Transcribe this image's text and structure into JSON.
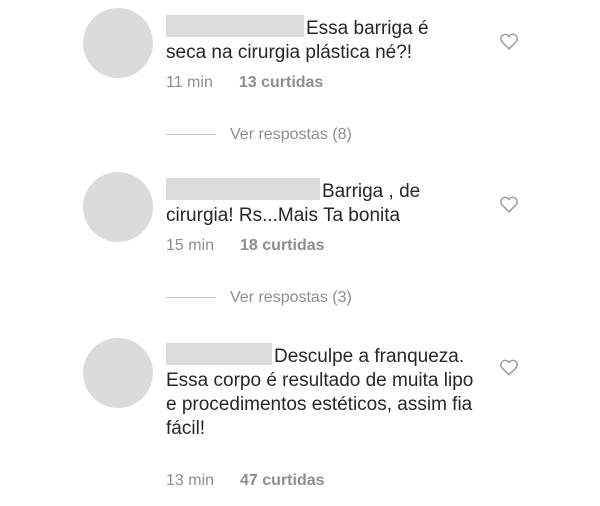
{
  "comments": [
    {
      "text": "Essa barriga é seca na cirurgia plástica né?!",
      "time": "11 min",
      "likes": "13 curtidas",
      "replies": "Ver respostas (8)"
    },
    {
      "text": "Barriga , de cirurgia! Rs...Mais Ta bonita",
      "time": "15 min",
      "likes": "18 curtidas",
      "replies": "Ver respostas (3)"
    },
    {
      "text": "Desculpe a franqueza. Essa corpo é resultado de muita lipo e procedimentos estéticos,  assim fia fácil!",
      "time": "13 min",
      "likes": "47 curtidas"
    }
  ],
  "icons": {
    "like": "heart-outline-icon"
  }
}
